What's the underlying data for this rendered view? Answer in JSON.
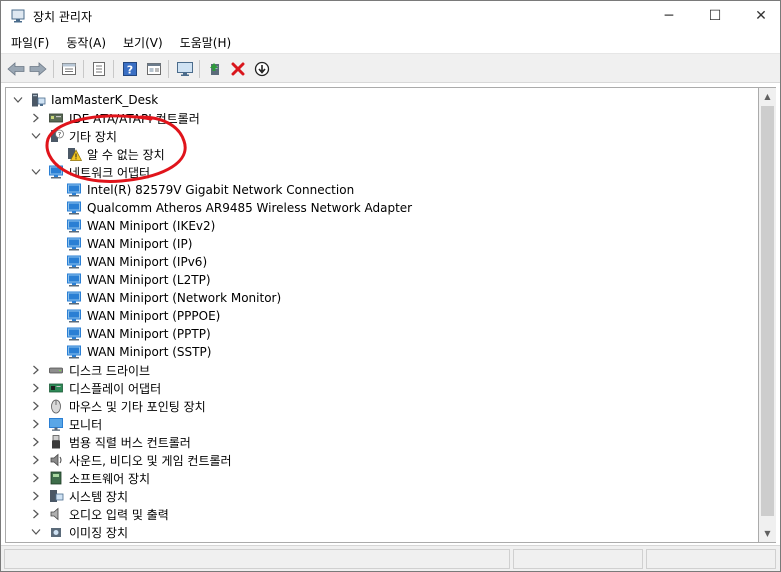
{
  "window": {
    "title": "장치 관리자",
    "controls": {
      "minimize": "─",
      "maximize": "☐",
      "close": "✕"
    }
  },
  "menu": [
    "파일(F)",
    "동작(A)",
    "보기(V)",
    "도움말(H)"
  ],
  "toolbar": {
    "buttons": [
      "back-icon",
      "forward-icon",
      "properties-icon",
      "show-hide-icon",
      "help-icon",
      "view-icon",
      "scan-hardware-icon",
      "update-driver-icon",
      "uninstall-icon",
      "disable-icon"
    ]
  },
  "tree": {
    "root": "IamMasterK_Desk",
    "items": [
      {
        "label": "IDE ATA/ATAPI 컨트롤러",
        "level": 1,
        "expanded": false,
        "icon": "ide-controller-icon"
      },
      {
        "label": "기타 장치",
        "level": 1,
        "expanded": true,
        "icon": "other-devices-icon"
      },
      {
        "label": "알 수 없는 장치",
        "level": 2,
        "icon": "unknown-device-warning-icon"
      },
      {
        "label": "네트워크 어댑터",
        "level": 1,
        "expanded": true,
        "icon": "network-adapter-icon"
      },
      {
        "label": "Intel(R) 82579V Gigabit Network Connection",
        "level": 2,
        "icon": "network-adapter-icon"
      },
      {
        "label": "Qualcomm Atheros AR9485 Wireless Network Adapter",
        "level": 2,
        "icon": "network-adapter-icon"
      },
      {
        "label": "WAN Miniport (IKEv2)",
        "level": 2,
        "icon": "network-adapter-icon"
      },
      {
        "label": "WAN Miniport (IP)",
        "level": 2,
        "icon": "network-adapter-icon"
      },
      {
        "label": "WAN Miniport (IPv6)",
        "level": 2,
        "icon": "network-adapter-icon"
      },
      {
        "label": "WAN Miniport (L2TP)",
        "level": 2,
        "icon": "network-adapter-icon"
      },
      {
        "label": "WAN Miniport (Network Monitor)",
        "level": 2,
        "icon": "network-adapter-icon"
      },
      {
        "label": "WAN Miniport (PPPOE)",
        "level": 2,
        "icon": "network-adapter-icon"
      },
      {
        "label": "WAN Miniport (PPTP)",
        "level": 2,
        "icon": "network-adapter-icon"
      },
      {
        "label": "WAN Miniport (SSTP)",
        "level": 2,
        "icon": "network-adapter-icon"
      },
      {
        "label": "디스크 드라이브",
        "level": 1,
        "expanded": false,
        "icon": "disk-drive-icon"
      },
      {
        "label": "디스플레이 어댑터",
        "level": 1,
        "expanded": false,
        "icon": "display-adapter-icon"
      },
      {
        "label": "마우스 및 기타 포인팅 장치",
        "level": 1,
        "expanded": false,
        "icon": "mouse-icon"
      },
      {
        "label": "모니터",
        "level": 1,
        "expanded": false,
        "icon": "monitor-icon"
      },
      {
        "label": "범용 직렬 버스 컨트롤러",
        "level": 1,
        "expanded": false,
        "icon": "usb-icon"
      },
      {
        "label": "사운드, 비디오 및 게임 컨트롤러",
        "level": 1,
        "expanded": false,
        "icon": "speaker-icon"
      },
      {
        "label": "소프트웨어 장치",
        "level": 1,
        "expanded": false,
        "icon": "software-device-icon"
      },
      {
        "label": "시스템 장치",
        "level": 1,
        "expanded": false,
        "icon": "system-device-icon"
      },
      {
        "label": "오디오 입력 및 출력",
        "level": 1,
        "expanded": false,
        "icon": "audio-io-icon"
      },
      {
        "label": "이미징 장치",
        "level": 1,
        "expanded": true,
        "icon": "imaging-device-icon"
      }
    ]
  },
  "colors": {
    "annotation_red": "#e0141b",
    "network_blue": "#2a7fd4",
    "warning_yellow": "#f3c623",
    "uninstall_red": "#d9161c",
    "update_green": "#2e9a3a"
  }
}
